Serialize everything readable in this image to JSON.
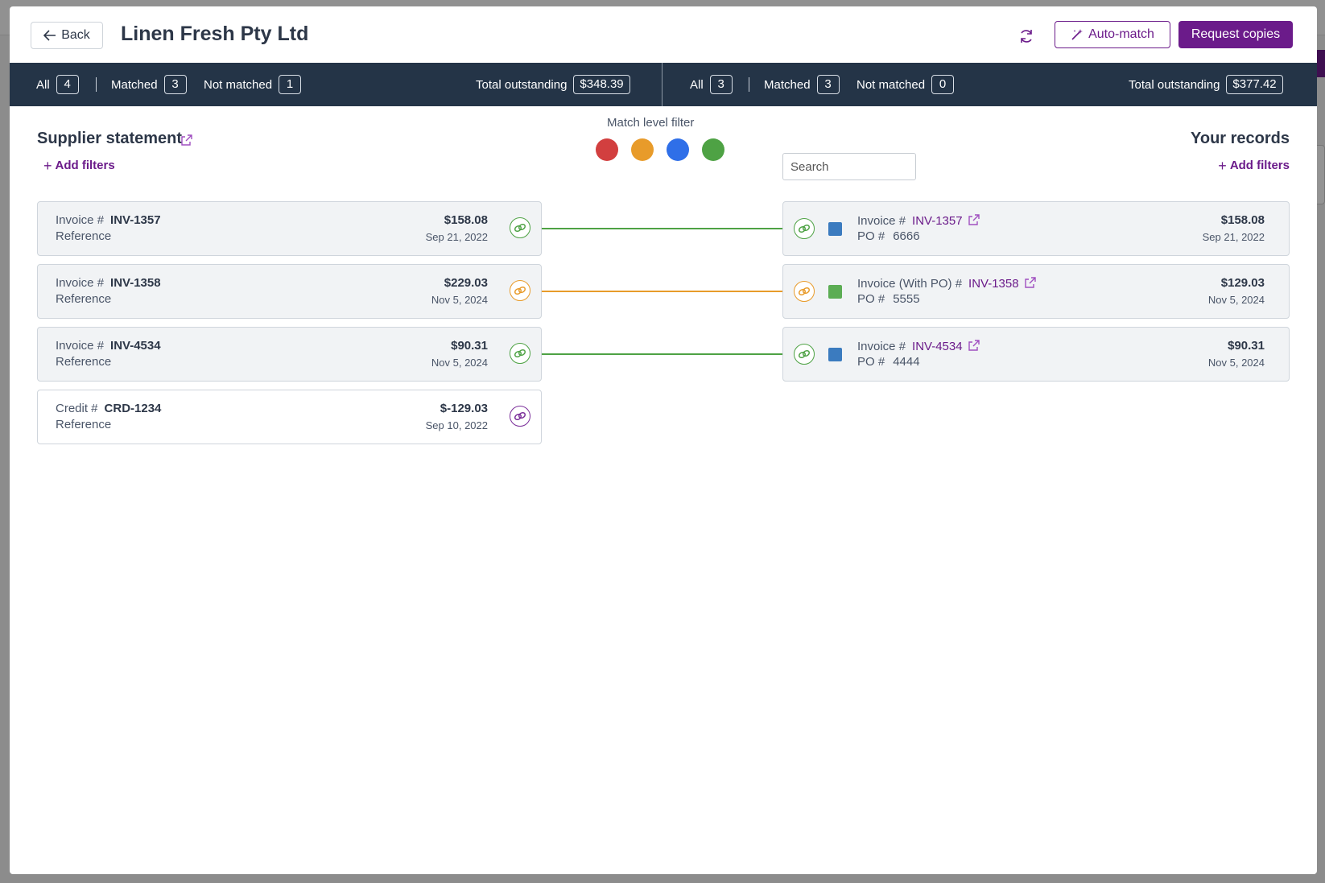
{
  "colors": {
    "accent": "#6b1b8a",
    "header_bar": "#243447",
    "red": "#d23f3f",
    "orange": "#e89b2a",
    "blue": "#2f6fe8",
    "green": "#4ea244",
    "swatch_blue": "#3b7bbf",
    "swatch_green": "#5cad54"
  },
  "header": {
    "back_label": "Back",
    "title": "Linen Fresh Pty Ltd",
    "auto_match_label": "Auto-match",
    "request_copies_label": "Request copies"
  },
  "stats": {
    "left": {
      "all_label": "All",
      "all_count": "4",
      "matched_label": "Matched",
      "matched_count": "3",
      "not_matched_label": "Not matched",
      "not_matched_count": "1",
      "total_label": "Total outstanding",
      "total_value": "$348.39"
    },
    "right": {
      "all_label": "All",
      "all_count": "3",
      "matched_label": "Matched",
      "matched_count": "3",
      "not_matched_label": "Not matched",
      "not_matched_count": "0",
      "total_label": "Total outstanding",
      "total_value": "$377.42"
    }
  },
  "supplier": {
    "title": "Supplier statement",
    "add_filters": "Add filters",
    "items": [
      {
        "type_label": "Invoice #",
        "number": "INV-1357",
        "ref_label": "Reference",
        "amount": "$158.08",
        "date": "Sep 21, 2022",
        "match_color": "green"
      },
      {
        "type_label": "Invoice #",
        "number": "INV-1358",
        "ref_label": "Reference",
        "amount": "$229.03",
        "date": "Nov 5, 2024",
        "match_color": "orange"
      },
      {
        "type_label": "Invoice #",
        "number": "INV-4534",
        "ref_label": "Reference",
        "amount": "$90.31",
        "date": "Nov 5, 2024",
        "match_color": "green"
      },
      {
        "type_label": "Credit #",
        "number": "CRD-1234",
        "ref_label": "Reference",
        "amount": "$-129.03",
        "date": "Sep 10, 2022",
        "match_color": "purple"
      }
    ]
  },
  "match_filter": {
    "label": "Match level filter",
    "levels": [
      "red",
      "orange",
      "blue",
      "green"
    ]
  },
  "search": {
    "placeholder": "Search"
  },
  "records": {
    "title": "Your records",
    "add_filters": "Add filters",
    "items": [
      {
        "type_label": "Invoice #",
        "number": "INV-1357",
        "po_label": "PO #",
        "po": "6666",
        "amount": "$158.08",
        "date": "Sep 21, 2022",
        "swatch": "blue",
        "match_color": "green"
      },
      {
        "type_label": "Invoice (With PO) #",
        "number": "INV-1358",
        "po_label": "PO #",
        "po": "5555",
        "amount": "$129.03",
        "date": "Nov 5, 2024",
        "swatch": "green",
        "match_color": "orange"
      },
      {
        "type_label": "Invoice #",
        "number": "INV-4534",
        "po_label": "PO #",
        "po": "4444",
        "amount": "$90.31",
        "date": "Nov 5, 2024",
        "swatch": "blue",
        "match_color": "green"
      }
    ]
  }
}
